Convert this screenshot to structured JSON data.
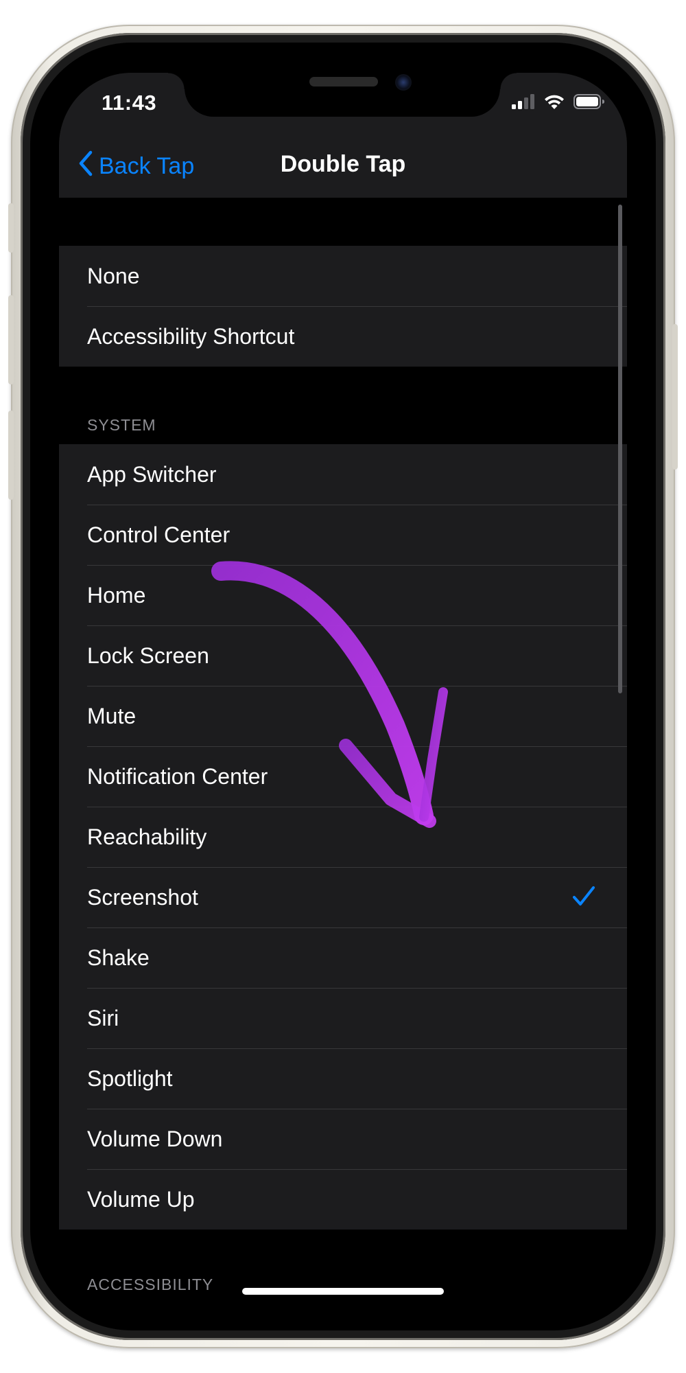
{
  "status_bar": {
    "time": "11:43"
  },
  "nav": {
    "back_label": "Back Tap",
    "title": "Double Tap"
  },
  "top_group": {
    "items": [
      {
        "label": "None"
      },
      {
        "label": "Accessibility Shortcut"
      }
    ]
  },
  "system_section": {
    "header": "SYSTEM",
    "items": [
      {
        "label": "App Switcher"
      },
      {
        "label": "Control Center"
      },
      {
        "label": "Home"
      },
      {
        "label": "Lock Screen"
      },
      {
        "label": "Mute"
      },
      {
        "label": "Notification Center"
      },
      {
        "label": "Reachability"
      },
      {
        "label": "Screenshot",
        "selected": true
      },
      {
        "label": "Shake"
      },
      {
        "label": "Siri"
      },
      {
        "label": "Spotlight"
      },
      {
        "label": "Volume Down"
      },
      {
        "label": "Volume Up"
      }
    ]
  },
  "accessibility_section": {
    "header": "ACCESSIBILITY"
  },
  "icons": {
    "back": "chevron-left-icon",
    "check": "checkmark-icon",
    "signal": "cellular-signal-icon",
    "wifi": "wifi-icon",
    "battery": "battery-icon",
    "annotation": "arrow-annotation"
  },
  "colors": {
    "accent": "#0a84ff",
    "background": "#000000",
    "cell": "#1c1c1e",
    "annotation": "#b43be3"
  }
}
